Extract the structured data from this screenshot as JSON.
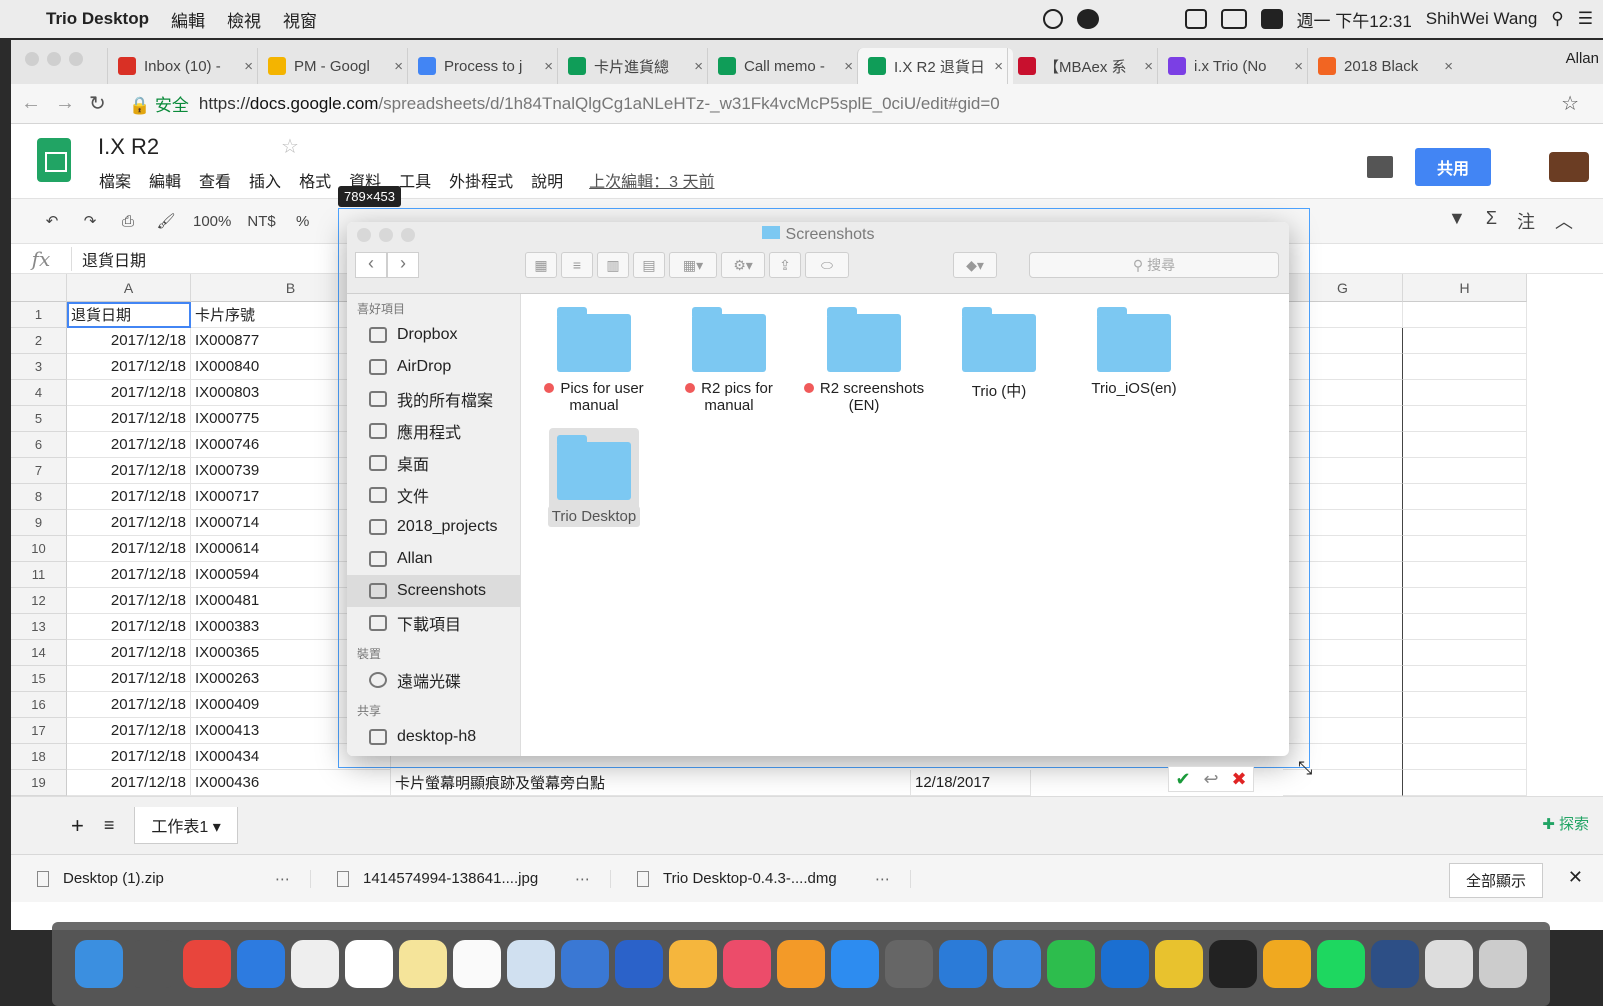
{
  "menubar": {
    "app": "Trio Desktop",
    "items": [
      "編輯",
      "檢視",
      "視窗"
    ],
    "clock": "週一 下午12:31",
    "user": "ShihWei Wang"
  },
  "browser": {
    "tabs": [
      {
        "label": "Inbox (10) -",
        "color": "#d93025"
      },
      {
        "label": "PM - Googl",
        "color": "#f4b400"
      },
      {
        "label": "Process to j",
        "color": "#4285f4"
      },
      {
        "label": "卡片進貨總",
        "color": "#0f9d58"
      },
      {
        "label": "Call memo -",
        "color": "#0f9d58"
      },
      {
        "label": "I.X R2 退貨日",
        "color": "#0f9d58"
      },
      {
        "label": "【MBAex 系",
        "color": "#c8102e"
      },
      {
        "label": "i.x Trio (No",
        "color": "#7b3fe4"
      },
      {
        "label": "2018 Black",
        "color": "#f26522"
      }
    ],
    "active_tab_index": 5,
    "profile": "Allan",
    "secure_label": "安全",
    "url_scheme": "https://",
    "url_host": "docs.google.com",
    "url_path": "/spreadsheets/d/1h84TnalQlgCg1aNLeHTz-_w31Fk4vcMcP5splE_0ciU/edit#gid=0"
  },
  "sheets": {
    "title": "I.X R2",
    "menu": [
      "檔案",
      "編輯",
      "查看",
      "插入",
      "格式",
      "資料",
      "工具",
      "外掛程式",
      "說明"
    ],
    "last_edit": "上次編輯：3 天前",
    "share": "共用",
    "toolbar": {
      "zoom": "100%",
      "currency": "NT$",
      "percent": "%",
      "comment": "注"
    },
    "formula_value": "退貨日期",
    "columns": [
      "A",
      "B",
      "G",
      "H"
    ],
    "header_row": [
      "退貨日期",
      "卡片序號"
    ],
    "rows": [
      {
        "n": "1",
        "date": "退貨日期",
        "id": "卡片序號"
      },
      {
        "n": "2",
        "date": "2017/12/18",
        "id": "IX000877"
      },
      {
        "n": "3",
        "date": "2017/12/18",
        "id": "IX000840"
      },
      {
        "n": "4",
        "date": "2017/12/18",
        "id": "IX000803"
      },
      {
        "n": "5",
        "date": "2017/12/18",
        "id": "IX000775"
      },
      {
        "n": "6",
        "date": "2017/12/18",
        "id": "IX000746"
      },
      {
        "n": "7",
        "date": "2017/12/18",
        "id": "IX000739"
      },
      {
        "n": "8",
        "date": "2017/12/18",
        "id": "IX000717"
      },
      {
        "n": "9",
        "date": "2017/12/18",
        "id": "IX000714"
      },
      {
        "n": "10",
        "date": "2017/12/18",
        "id": "IX000614"
      },
      {
        "n": "11",
        "date": "2017/12/18",
        "id": "IX000594"
      },
      {
        "n": "12",
        "date": "2017/12/18",
        "id": "IX000481"
      },
      {
        "n": "13",
        "date": "2017/12/18",
        "id": "IX000383"
      },
      {
        "n": "14",
        "date": "2017/12/18",
        "id": "IX000365"
      },
      {
        "n": "15",
        "date": "2017/12/18",
        "id": "IX000263"
      },
      {
        "n": "16",
        "date": "2017/12/18",
        "id": "IX000409"
      },
      {
        "n": "17",
        "date": "2017/12/18",
        "id": "IX000413"
      },
      {
        "n": "18",
        "date": "2017/12/18",
        "id": "IX000434"
      },
      {
        "n": "19",
        "date": "2017/12/18",
        "id": "IX000436"
      }
    ],
    "row19_note": "卡片螢幕明顯痕跡及螢幕旁白點",
    "row19_date2": "12/18/2017",
    "sheet_tab": "工作表1",
    "explore": "探索"
  },
  "downloads": {
    "items": [
      "Desktop (1).zip",
      "1414574994-138641....jpg",
      "Trio Desktop-0.4.3-....dmg"
    ],
    "show_all": "全部顯示"
  },
  "capture": {
    "size_label": "789×453"
  },
  "finder": {
    "title": "Screenshots",
    "search_placeholder": "搜尋",
    "sections": {
      "favorites": "喜好項目",
      "devices": "裝置",
      "shared": "共享"
    },
    "favorites": [
      "Dropbox",
      "AirDrop",
      "我的所有檔案",
      "應用程式",
      "桌面",
      "文件",
      "2018_projects",
      "Allan",
      "Screenshots",
      "下載項目"
    ],
    "active_favorite": "Screenshots",
    "devices": [
      "遠端光碟"
    ],
    "shared": [
      "desktop-h8"
    ],
    "folders": [
      {
        "name": "Pics for user manual",
        "tag": true
      },
      {
        "name": "R2 pics for manual",
        "tag": true
      },
      {
        "name": "R2 screenshots (EN)",
        "tag": true
      },
      {
        "name": "Trio (中)",
        "tag": false
      },
      {
        "name": "Trio_iOS(en)",
        "tag": false
      },
      {
        "name": "Trio Desktop",
        "tag": false,
        "selected": true
      }
    ]
  },
  "dock": {
    "colors": [
      "#3b8fe0",
      "#555",
      "#e8453c",
      "#2d7be0",
      "#eee",
      "#fff",
      "#f5e49a",
      "#fafafa",
      "#d0e0f0",
      "#3a78d4",
      "#2b62c9",
      "#f5b63d",
      "#ec4c6a",
      "#f39a28",
      "#2d8cf0",
      "#666",
      "#2b7bd8",
      "#3a88e0",
      "#2dbd4d",
      "#1b6fd1",
      "#e8c22e",
      "#222",
      "#f0a920",
      "#1ed760",
      "#2d4f86",
      "#ddd",
      "#ccc"
    ]
  }
}
